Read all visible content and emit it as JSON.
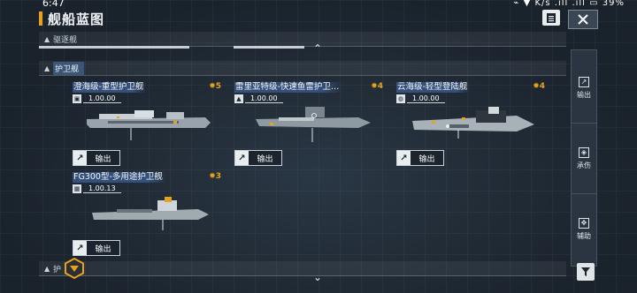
{
  "status_bar": {
    "time": "6:47",
    "right_text": "⌁ ▼ K/s .ıll .ıll ▭ 39%"
  },
  "header": {
    "title": "舰船蓝图",
    "doc_icon": "document-icon",
    "close_icon": "close-icon"
  },
  "sections": {
    "destroyer": {
      "label": "驱逐舰",
      "arrow": "▲"
    },
    "escort": {
      "label": "护卫舰",
      "arrow": "▲"
    },
    "bottom": {
      "label": "护",
      "arrow": "▲"
    }
  },
  "cards": [
    {
      "name": "澄海级-重型护卫舰",
      "cost": "5",
      "version": "1.00.00",
      "export_label": "输出"
    },
    {
      "name": "雷里亚特级-快速鱼雷护卫…",
      "cost": "4",
      "version": "1.00.00",
      "export_label": "输出"
    },
    {
      "name": "云海级-轻型登陆舰",
      "cost": "4",
      "version": "1.00.00",
      "export_label": "输出"
    },
    {
      "name": "FG300型-多用途护卫舰",
      "cost": "3",
      "version": "1.00.13",
      "export_label": "输出"
    }
  ],
  "sidebar": {
    "items": [
      {
        "label": "输出",
        "icon": "export-icon"
      },
      {
        "label": "承伤",
        "icon": "shield-icon"
      },
      {
        "label": "辅助",
        "icon": "support-icon"
      }
    ]
  },
  "colors": {
    "accent": "#e6a21c",
    "highlight": "#35507a",
    "bg": "#1d2630"
  }
}
